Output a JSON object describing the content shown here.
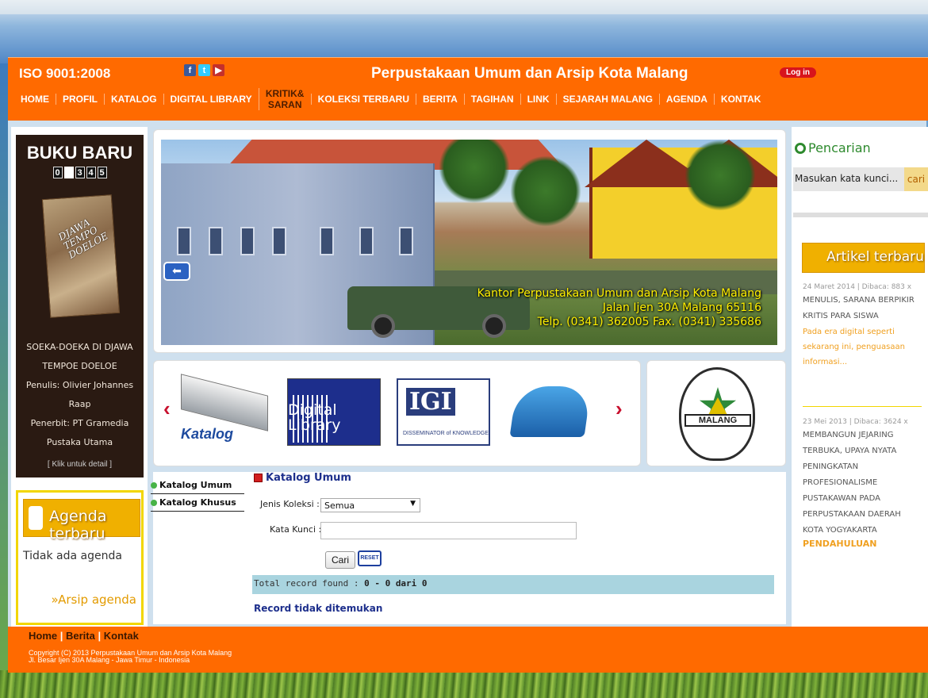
{
  "header": {
    "iso": "ISO 9001:2008",
    "title": "Perpustakaan Umum dan Arsip Kota Malang",
    "login": "Log in",
    "social": [
      {
        "icon": "facebook-icon",
        "glyph": "f"
      },
      {
        "icon": "twitter-icon",
        "glyph": "t"
      },
      {
        "icon": "youtube-icon",
        "glyph": "▶"
      }
    ]
  },
  "nav": [
    {
      "label": "HOME"
    },
    {
      "label": "PROFIL"
    },
    {
      "label": "KATALOG"
    },
    {
      "label": "DIGITAL LIBRARY"
    },
    {
      "label": "KRITIK& SARAN",
      "active": true
    },
    {
      "label": "KOLEKSI TERBARU"
    },
    {
      "label": "BERITA"
    },
    {
      "label": "TAGIHAN"
    },
    {
      "label": "LINK"
    },
    {
      "label": "SEJARAH MALANG"
    },
    {
      "label": "AGENDA"
    },
    {
      "label": "KONTAK"
    }
  ],
  "book": {
    "heading": "BUKU BARU",
    "counter": [
      "0",
      "",
      "3",
      "4",
      "5"
    ],
    "cover_title": "DJAWA TEMPO DOELOE",
    "title": "SOEKA-DOEKA DI DJAWA TEMPOE DOELOE",
    "author": "Penulis: Olivier Johannes Raap",
    "publisher": "Penerbit: PT Gramedia Pustaka Utama",
    "detail": "[ Klik untuk detail ]"
  },
  "agenda": {
    "title": "Agenda terbaru",
    "empty": "Tidak ada agenda",
    "archive": "»Arsip agenda"
  },
  "slider": {
    "caption_line1": "Kantor Perpustakaan Umum dan Arsip Kota Malang",
    "caption_line2": "Jalan Ijen 30A Malang 65116",
    "caption_line3": "Telp. (0341) 362005 Fax. (0341) 335686"
  },
  "carousel": {
    "items": [
      {
        "label": "Katalog"
      },
      {
        "label": "Digital Library"
      },
      {
        "label": "IGI",
        "sub": "DISSEMINATOR of KNOWLEDGE"
      },
      {
        "label": "mailbox"
      }
    ],
    "seal_text": "MALANG"
  },
  "catalog": {
    "nav": [
      "Katalog Umum",
      "Katalog Khusus"
    ],
    "title": "Katalog Umum",
    "jenis_label": "Jenis Koleksi :",
    "jenis_value": "Semua",
    "kunci_label": "Kata Kunci :",
    "kunci_value": "",
    "cari": "Cari",
    "reset": "RESET",
    "result_label": "Total record found :",
    "result_value": "0 - 0 dari 0",
    "not_found": "Record tidak ditemukan"
  },
  "search": {
    "title": "Pencarian",
    "placeholder": "Masukan kata kunci...",
    "button": "cari"
  },
  "articles": {
    "heading": "Artikel terbaru",
    "items": [
      {
        "meta": "24 Maret 2014 | Dibaca: 883 x",
        "title": "MENULIS, SARANA BERPIKIR KRITIS PARA SISWA",
        "excerpt": "Pada era digital seperti sekarang ini, penguasaan informasi..."
      },
      {
        "meta": "23 Mei 2013 | Dibaca: 3624 x",
        "title": "MEMBANGUN JEJARING TERBUKA, UPAYA NYATA PENINGKATAN PROFESIONALISME PUSTAKAWAN PADA PERPUSTAKAAN DAERAH KOTA YOGYAKARTA",
        "excerpt": "PENDAHULUAN"
      }
    ]
  },
  "footer": {
    "links": [
      "Home",
      "Berita",
      "Kontak"
    ],
    "copyright": "Copyright (C) 2013 Perpustakaan Umum dan Arsip Kota Malang",
    "address": "Jl. Besar Ijen 30A Malang - Jawa Timur - Indonesia"
  },
  "colors": {
    "brand": "#ff6a00",
    "accent": "#f0b000",
    "link": "#1d2f8c"
  }
}
